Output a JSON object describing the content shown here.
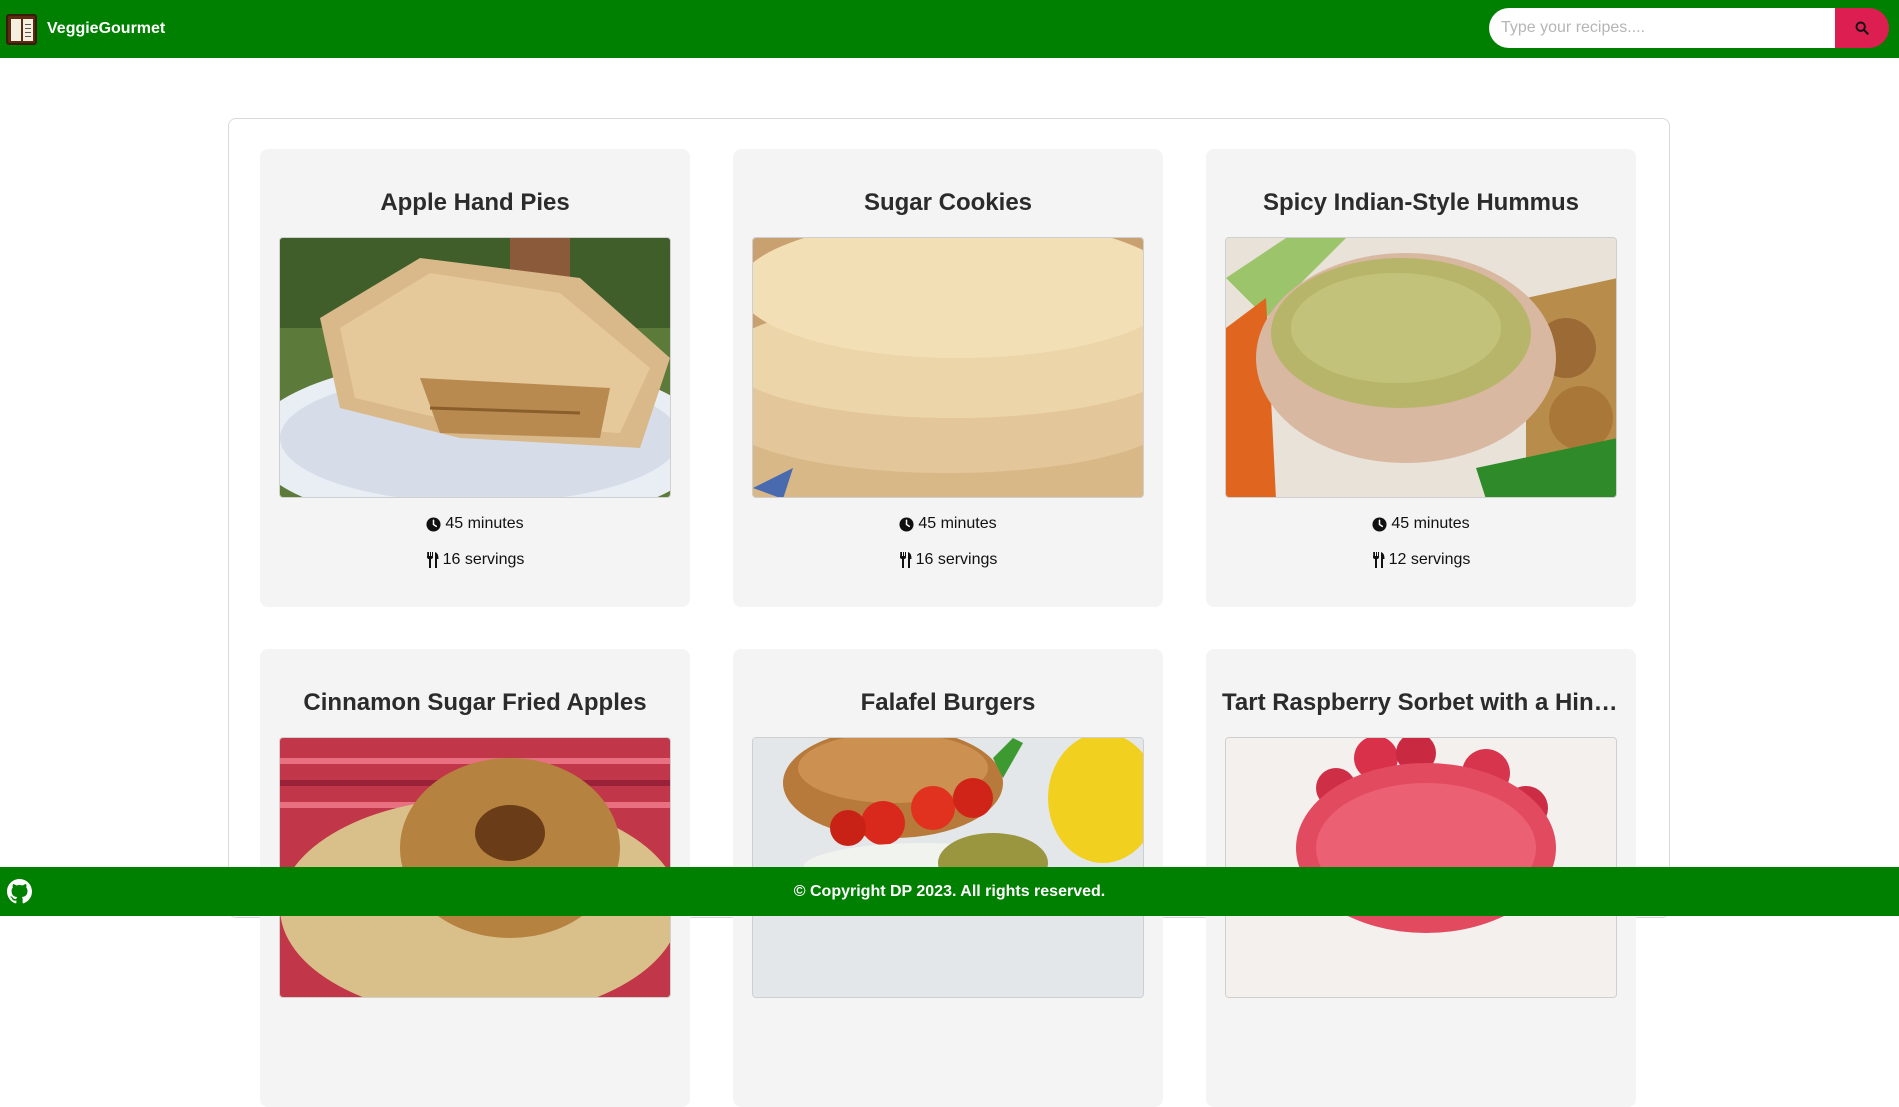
{
  "navbar": {
    "brand": "VeggieGourmet",
    "search_placeholder": "Type your recipes....",
    "colors": {
      "background": "#008000",
      "search_button": "#dc1e50"
    }
  },
  "recipes": [
    {
      "title": "Apple Hand Pies",
      "time": "45 minutes",
      "servings": "16 servings",
      "image": "apple-hand-pies-photo"
    },
    {
      "title": "Sugar Cookies",
      "time": "45 minutes",
      "servings": "16 servings",
      "image": "sugar-cookies-photo"
    },
    {
      "title": "Spicy Indian-Style Hummus",
      "time": "45 minutes",
      "servings": "12 servings",
      "image": "hummus-photo"
    },
    {
      "title": "Cinnamon Sugar Fried Apples",
      "time": "",
      "servings": "",
      "image": "fried-apples-photo"
    },
    {
      "title": "Falafel Burgers",
      "time": "",
      "servings": "",
      "image": "falafel-burger-photo"
    },
    {
      "title": "Tart Raspberry Sorbet with a Hint ...",
      "time": "",
      "servings": "",
      "image": "raspberry-sorbet-photo"
    }
  ],
  "footer": {
    "copyright": "© Copyright DP 2023. All rights reserved.",
    "github_icon": "github-icon"
  }
}
